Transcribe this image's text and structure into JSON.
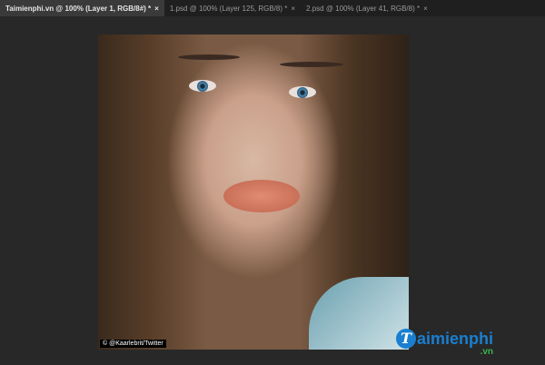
{
  "tabs": [
    {
      "label": "Taimienphi.vn @ 100% (Layer 1, RGB/8#) *",
      "active": true
    },
    {
      "label": "1.psd @ 100% (Layer 125, RGB/8) *",
      "active": false
    },
    {
      "label": "2.psd @ 100% (Layer 41, RGB/8) *",
      "active": false
    }
  ],
  "close_glyph": "×",
  "canvas": {
    "credit": "© @Kaarlebrit/Twitter"
  },
  "watermark": {
    "initial": "T",
    "name": "aimienphi",
    "suffix": ".vn"
  }
}
